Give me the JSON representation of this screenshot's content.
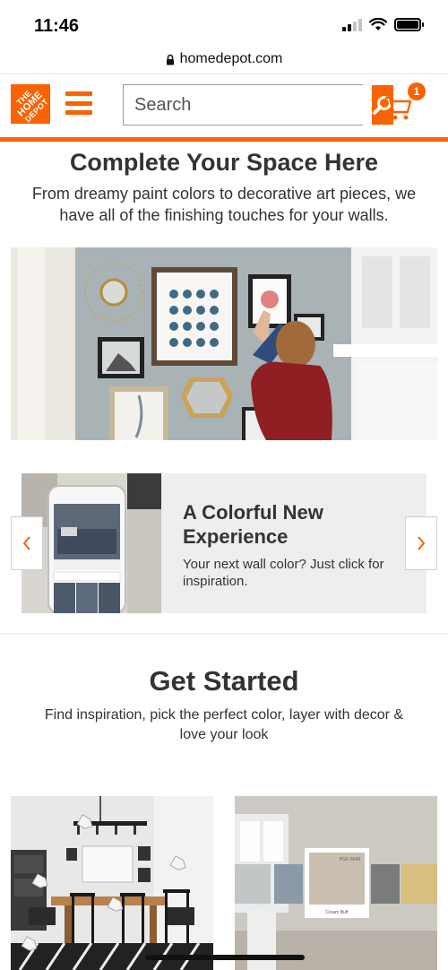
{
  "status_bar": {
    "time": "11:46"
  },
  "url_bar": {
    "domain": "homedepot.com"
  },
  "header": {
    "logo_text": [
      "THE",
      "HOME",
      "DEPOT"
    ],
    "search_placeholder": "Search",
    "cart_count": "1"
  },
  "hero": {
    "title": "Complete Your Space Here",
    "subtitle": "From dreamy paint colors to decorative art pieces, we have all of the finishing touches for your walls."
  },
  "carousel": {
    "title": "A Colorful New Experience",
    "text": "Your next wall color? Just click for inspiration."
  },
  "get_started": {
    "title": "Get Started",
    "subtitle": "Find inspiration, pick the perfect color, layer with decor & love your look",
    "swatch_code": "PGF-6048",
    "swatch_name": "Cream Buff"
  },
  "colors": {
    "brand_orange": "#f96302",
    "text": "#333333"
  },
  "icons": [
    "lock-icon",
    "menu-icon",
    "search-icon",
    "cart-icon",
    "chevron-left-icon",
    "chevron-right-icon"
  ]
}
